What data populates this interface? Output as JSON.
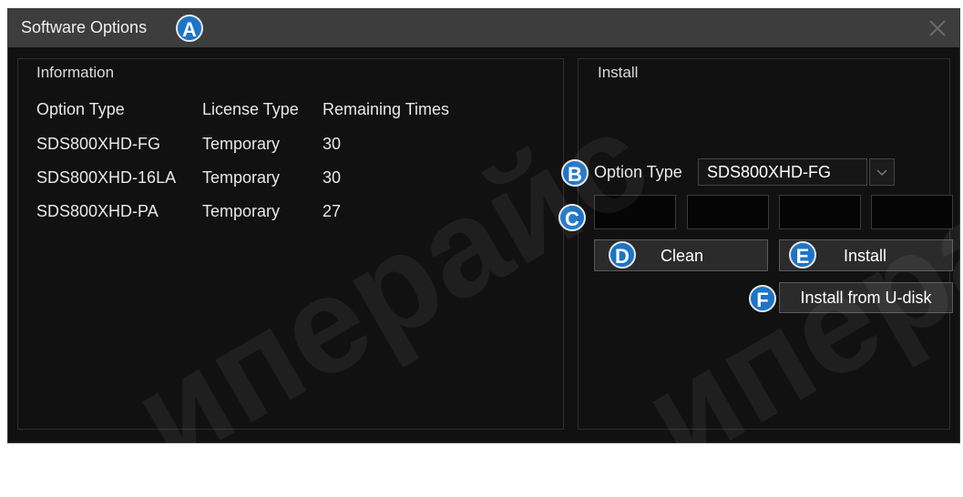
{
  "dialog": {
    "title": "Software Options",
    "callouts": {
      "a": "A",
      "b": "B",
      "c": "C",
      "d": "D",
      "e": "E",
      "f": "F"
    }
  },
  "information": {
    "title": "Information",
    "columns": [
      "Option Type",
      "License Type",
      "Remaining Times"
    ],
    "rows": [
      [
        "SDS800XHD-FG",
        "Temporary",
        "30"
      ],
      [
        "SDS800XHD-16LA",
        "Temporary",
        "30"
      ],
      [
        "SDS800XHD-PA",
        "Temporary",
        "27"
      ]
    ]
  },
  "install": {
    "title": "Install",
    "option_type_label": "Option Type",
    "option_type_value": "SDS800XHD-FG",
    "clean_label": "Clean",
    "install_label": "Install",
    "install_udisk_label": "Install from U-disk"
  },
  "watermark": "иперайс",
  "colors": {
    "badge": "#1d74c6",
    "titlebar": "#3d3d3d",
    "background": "#111111"
  }
}
